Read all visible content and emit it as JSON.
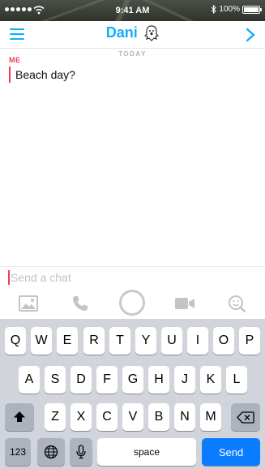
{
  "status_bar": {
    "time": "9:41 AM",
    "battery": "100%",
    "battery_level": 1.0
  },
  "header": {
    "title": "Dani"
  },
  "conversation": {
    "date": "TODAY",
    "messages": [
      {
        "sender": "ME",
        "text": "Beach day?"
      }
    ]
  },
  "composer": {
    "placeholder": "Send a chat"
  },
  "keyboard": {
    "row1": [
      "Q",
      "W",
      "E",
      "R",
      "T",
      "Y",
      "U",
      "I",
      "O",
      "P"
    ],
    "row2": [
      "A",
      "S",
      "D",
      "F",
      "G",
      "H",
      "J",
      "K",
      "L"
    ],
    "row3": [
      "Z",
      "X",
      "C",
      "V",
      "B",
      "N",
      "M"
    ],
    "numbers_label": "123",
    "space_label": "space",
    "send_label": "Send"
  },
  "colors": {
    "accent": "#0fadff",
    "me": "#f23c57",
    "send_button": "#0a7cff"
  }
}
